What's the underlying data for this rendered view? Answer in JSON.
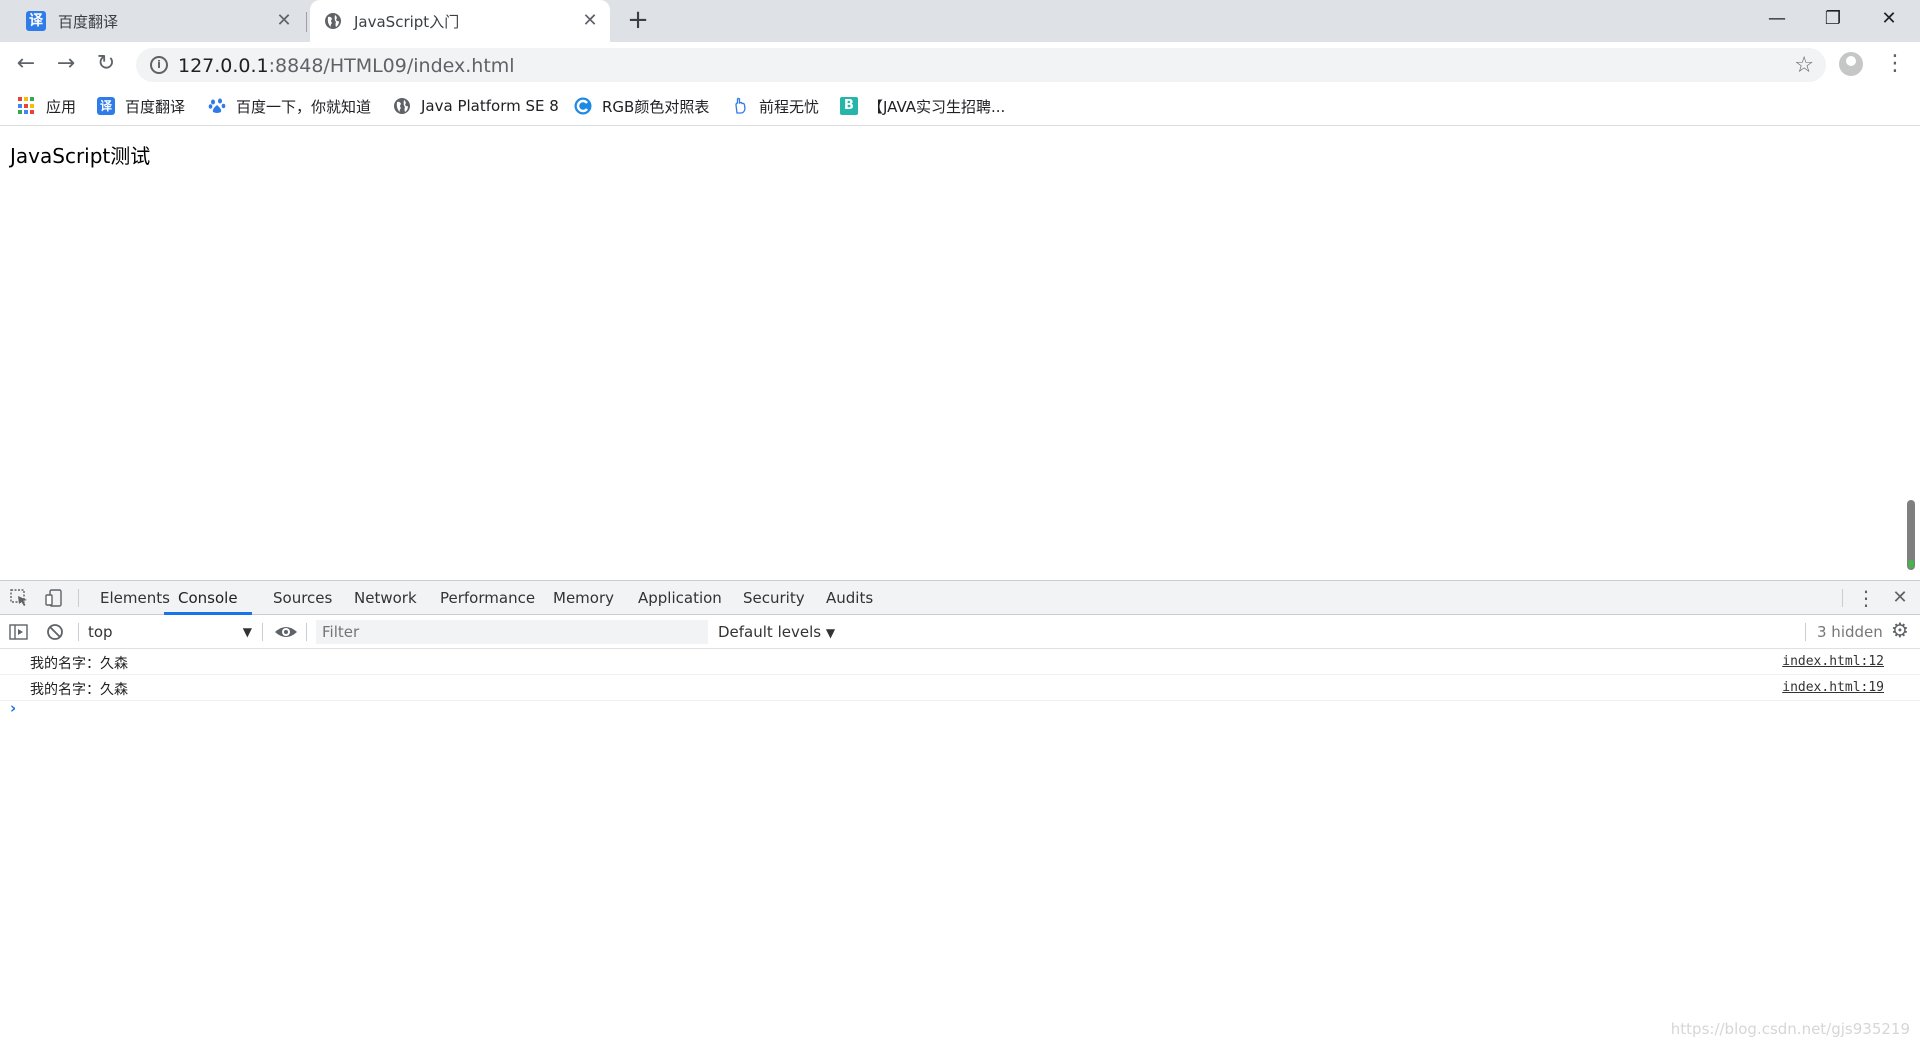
{
  "tabs": [
    {
      "title": "百度翻译",
      "icon": "fanyi-icon",
      "active": false
    },
    {
      "title": "JavaScript入门",
      "icon": "globe-icon",
      "active": true
    }
  ],
  "tab_close_glyph": "✕",
  "new_tab_glyph": "+",
  "window_controls": {
    "minimize": "—",
    "maximize": "❐",
    "close": "✕"
  },
  "toolbar": {
    "url_host": "127.0.0.1",
    "url_rest": ":8848/HTML09/index.html",
    "back_glyph": "←",
    "forward_glyph": "→",
    "reload_glyph": "↻",
    "star_glyph": "☆",
    "menu_glyph": "⋮"
  },
  "bookmarks": [
    {
      "label": "应用",
      "icon": "apps-icon"
    },
    {
      "label": "百度翻译",
      "icon": "fanyi-icon"
    },
    {
      "label": "百度一下，你就知道",
      "icon": "baidu-paw-icon"
    },
    {
      "label": "Java Platform SE 8",
      "icon": "globe-icon"
    },
    {
      "label": "RGB颜色对照表",
      "icon": "c-logo-icon"
    },
    {
      "label": "前程无忧",
      "icon": "hand-icon"
    },
    {
      "label": "【JAVA实习生招聘...",
      "icon": "b-logo-icon"
    }
  ],
  "page": {
    "heading": "JavaScript测试"
  },
  "devtools": {
    "tabs": [
      "Elements",
      "Console",
      "Sources",
      "Network",
      "Performance",
      "Memory",
      "Application",
      "Security",
      "Audits"
    ],
    "active_tab": "Console",
    "context": "top",
    "filter_placeholder": "Filter",
    "levels_label": "Default levels",
    "hidden_label": "3 hidden",
    "messages": [
      {
        "text": "我的名字：久森",
        "source": "index.html:12"
      },
      {
        "text": "我的名字：久森",
        "source": "index.html:19"
      }
    ],
    "prompt_glyph": "›"
  },
  "watermark": "https://blog.csdn.net/gjs935219",
  "colors": {
    "accent": "#1a73e8",
    "tabstrip": "#dee1e6",
    "fanyi_blue": "#2f7bea"
  }
}
